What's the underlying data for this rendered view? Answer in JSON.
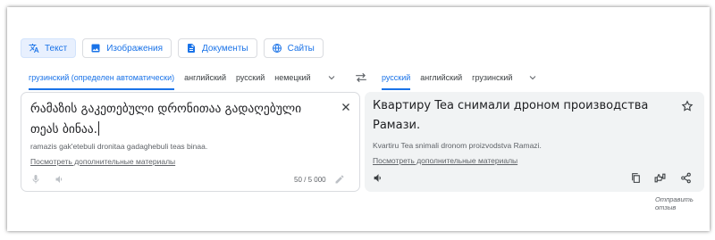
{
  "mode_tabs": [
    {
      "label": "Текст",
      "icon": "translate-icon",
      "active": true
    },
    {
      "label": "Изображения",
      "icon": "image-icon",
      "active": false
    },
    {
      "label": "Документы",
      "icon": "document-icon",
      "active": false
    },
    {
      "label": "Сайты",
      "icon": "globe-icon",
      "active": false
    }
  ],
  "source_langs": [
    "грузинский (определен автоматически)",
    "английский",
    "русский",
    "немецкий"
  ],
  "target_langs": [
    "русский",
    "английский",
    "грузинский"
  ],
  "source": {
    "text": "რამაზის გაკეთებული დრონითაა გადაღებული თეას ბინაა.",
    "transliteration": "ramazis gak'etebuli dronitaa gadaghebuli teas binaa.",
    "more_link": "Посмотреть дополнительные материалы",
    "char_count": "50 / 5 000"
  },
  "target": {
    "text": "Квартиру Tea снимали дроном производства Рамази.",
    "transliteration": "Kvartiru Tea snimali dronom proizvodstva Ramazi.",
    "more_link": "Посмотреть дополнительные материалы"
  },
  "feedback": "Отправить отзыв",
  "colors": {
    "accent": "#1a73e8",
    "active_tab_bg": "#e8f0fe",
    "target_panel_bg": "#f1f3f4"
  }
}
